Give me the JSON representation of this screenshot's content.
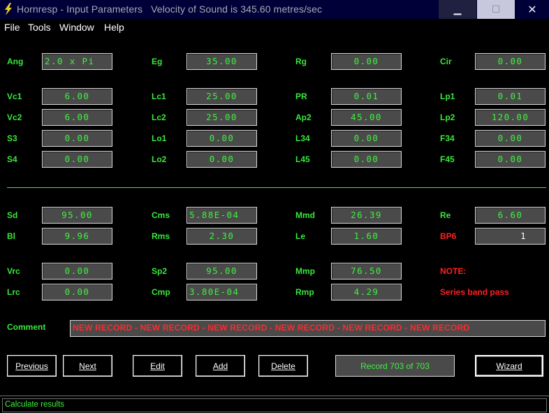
{
  "window": {
    "title": "Hornresp - Input Parameters",
    "velocity_text": "Velocity of Sound is 345.60 metres/sec",
    "minimize": "▁",
    "maximize": "☐",
    "close": "✕"
  },
  "menu": [
    "File",
    "Tools",
    "Window",
    "Help"
  ],
  "rows": [
    [
      {
        "label": "Ang",
        "value": "2.0 x Pi",
        "align": "left"
      },
      {
        "label": "Eg",
        "value": "35.00"
      },
      {
        "label": "Rg",
        "value": "0.00"
      },
      {
        "label": "Cir",
        "value": "0.00"
      }
    ],
    [
      {
        "label": "Vc1",
        "value": "6.00"
      },
      {
        "label": "Lc1",
        "value": "25.00"
      },
      {
        "label": "PR",
        "value": "0.01"
      },
      {
        "label": "Lp1",
        "value": "0.01"
      }
    ],
    [
      {
        "label": "Vc2",
        "value": "6.00"
      },
      {
        "label": "Lc2",
        "value": "25.00"
      },
      {
        "label": "Ap2",
        "value": "45.00"
      },
      {
        "label": "Lp2",
        "value": "120.00"
      }
    ],
    [
      {
        "label": "S3",
        "value": "0.00"
      },
      {
        "label": "Lo1",
        "value": "0.00"
      },
      {
        "label": "L34",
        "value": "0.00"
      },
      {
        "label": "F34",
        "value": "0.00"
      }
    ],
    [
      {
        "label": "S4",
        "value": "0.00"
      },
      {
        "label": "Lo2",
        "value": "0.00"
      },
      {
        "label": "L45",
        "value": "0.00"
      },
      {
        "label": "F45",
        "value": "0.00"
      }
    ],
    [
      {
        "label": "Sd",
        "value": "95.00"
      },
      {
        "label": "Cms",
        "value": "5.88E-04",
        "align": "left"
      },
      {
        "label": "Mmd",
        "value": "26.39"
      },
      {
        "label": "Re",
        "value": "6.60"
      }
    ],
    [
      {
        "label": "Bl",
        "value": "9.96"
      },
      {
        "label": "Rms",
        "value": "2.30"
      },
      {
        "label": "Le",
        "value": "1.60"
      },
      {
        "label": "BP6",
        "value": "1",
        "align": "right",
        "red": true
      }
    ],
    [
      {
        "label": "Vrc",
        "value": "0.00"
      },
      {
        "label": "Sp2",
        "value": "95.00"
      },
      {
        "label": "Mmp",
        "value": "76.50"
      },
      {
        "label": "NOTE:",
        "red": true
      }
    ],
    [
      {
        "label": "Lrc",
        "value": "0.00"
      },
      {
        "label": "Cmp",
        "value": "3.80E-04",
        "align": "left"
      },
      {
        "label": "Rmp",
        "value": "4.29"
      },
      {
        "label": "Series band pass",
        "red": true
      }
    ]
  ],
  "comment": {
    "label": "Comment",
    "text": "NEW RECORD - NEW RECORD - NEW RECORD - NEW RECORD - NEW RECORD - NEW RECORD"
  },
  "buttons": {
    "previous": "Previous",
    "next": "Next",
    "edit": "Edit",
    "add": "Add",
    "delete": "Delete",
    "wizard": "Wizard"
  },
  "record": "Record 703 of 703",
  "status": "Calculate results",
  "colors": {
    "label_green": "#39e83b",
    "value_green": "#3ff03f",
    "note_red": "#ff2020",
    "field_bg": "#4a4a4a",
    "title_bg": "#000038"
  }
}
